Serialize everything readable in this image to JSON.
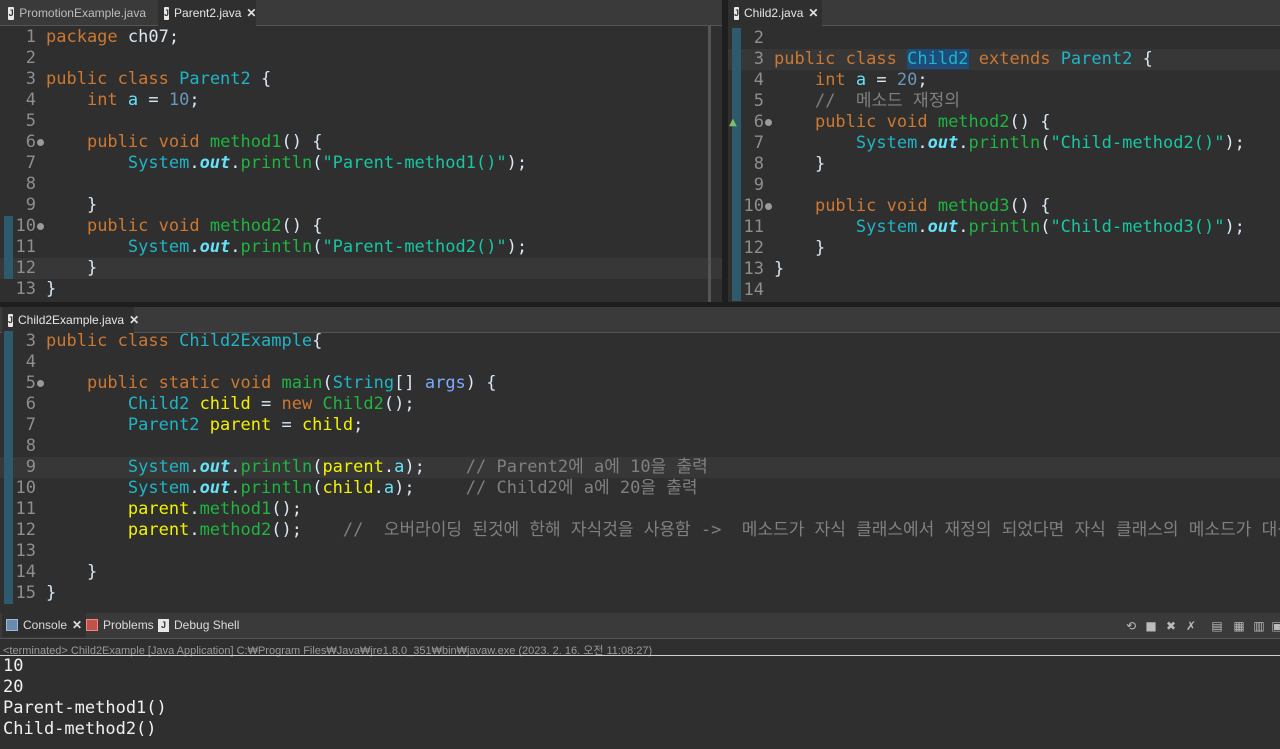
{
  "top_left": {
    "tabs": [
      {
        "label": "PromotionExample.java",
        "active": false,
        "closable": false
      },
      {
        "label": "Parent2.java",
        "active": true,
        "closable": true
      }
    ],
    "lines": [
      {
        "n": "1",
        "tokens": [
          [
            "kw",
            "package"
          ],
          [
            "plain",
            " ch07;"
          ]
        ]
      },
      {
        "n": "2",
        "tokens": []
      },
      {
        "n": "3",
        "tokens": [
          [
            "kw",
            "public"
          ],
          [
            "plain",
            " "
          ],
          [
            "kw",
            "class"
          ],
          [
            "plain",
            " "
          ],
          [
            "ty",
            "Parent2"
          ],
          [
            "plain",
            " {"
          ]
        ]
      },
      {
        "n": "4",
        "tokens": [
          [
            "plain",
            "    "
          ],
          [
            "kw",
            "int"
          ],
          [
            "plain",
            " "
          ],
          [
            "fld",
            "a"
          ],
          [
            "plain",
            " = "
          ],
          [
            "num",
            "10"
          ],
          [
            "plain",
            ";"
          ]
        ]
      },
      {
        "n": "5",
        "tokens": []
      },
      {
        "n": "6",
        "fold": true,
        "tokens": [
          [
            "plain",
            "    "
          ],
          [
            "kw",
            "public"
          ],
          [
            "plain",
            " "
          ],
          [
            "kw",
            "void"
          ],
          [
            "plain",
            " "
          ],
          [
            "fn",
            "method1"
          ],
          [
            "plain",
            "() {"
          ]
        ]
      },
      {
        "n": "7",
        "tokens": [
          [
            "plain",
            "        "
          ],
          [
            "ty",
            "System"
          ],
          [
            "plain",
            "."
          ],
          [
            "out",
            "out"
          ],
          [
            "plain",
            "."
          ],
          [
            "fn",
            "println"
          ],
          [
            "plain",
            "("
          ],
          [
            "st",
            "\"Parent-method1()\""
          ],
          [
            "plain",
            ");"
          ]
        ]
      },
      {
        "n": "8",
        "tokens": []
      },
      {
        "n": "9",
        "tokens": [
          [
            "plain",
            "    }"
          ]
        ]
      },
      {
        "n": "10",
        "fold": true,
        "mark": true,
        "tokens": [
          [
            "plain",
            "    "
          ],
          [
            "kw",
            "public"
          ],
          [
            "plain",
            " "
          ],
          [
            "kw",
            "void"
          ],
          [
            "plain",
            " "
          ],
          [
            "fn",
            "method2"
          ],
          [
            "plain",
            "() {"
          ]
        ]
      },
      {
        "n": "11",
        "mark": true,
        "tokens": [
          [
            "plain",
            "        "
          ],
          [
            "ty",
            "System"
          ],
          [
            "plain",
            "."
          ],
          [
            "out",
            "out"
          ],
          [
            "plain",
            "."
          ],
          [
            "fn",
            "println"
          ],
          [
            "plain",
            "("
          ],
          [
            "st",
            "\"Parent-method2()\""
          ],
          [
            "plain",
            ");"
          ]
        ]
      },
      {
        "n": "12",
        "mark": true,
        "highlight": true,
        "tokens": [
          [
            "plain",
            "    }"
          ]
        ]
      },
      {
        "n": "13",
        "tokens": [
          [
            "plain",
            "}"
          ]
        ]
      }
    ]
  },
  "top_right": {
    "tabs": [
      {
        "label": "Child2.java",
        "active": true,
        "closable": true
      }
    ],
    "lines": [
      {
        "n": "2",
        "tokens": []
      },
      {
        "n": "3",
        "highlight": true,
        "tokens": [
          [
            "kw",
            "public"
          ],
          [
            "plain",
            " "
          ],
          [
            "kw",
            "class"
          ],
          [
            "plain",
            " "
          ],
          [
            "tysel",
            "Child2"
          ],
          [
            "plain",
            " "
          ],
          [
            "kw",
            "extends"
          ],
          [
            "plain",
            " "
          ],
          [
            "ty",
            "Parent2"
          ],
          [
            "plain",
            " {"
          ]
        ]
      },
      {
        "n": "4",
        "tokens": [
          [
            "plain",
            "    "
          ],
          [
            "kw",
            "int"
          ],
          [
            "plain",
            " "
          ],
          [
            "fld",
            "a"
          ],
          [
            "plain",
            " = "
          ],
          [
            "num",
            "20"
          ],
          [
            "plain",
            ";"
          ]
        ]
      },
      {
        "n": "5",
        "tokens": [
          [
            "plain",
            "    "
          ],
          [
            "cm",
            "//  메소드 재정의"
          ]
        ]
      },
      {
        "n": "6",
        "fold": true,
        "override": true,
        "tokens": [
          [
            "plain",
            "    "
          ],
          [
            "kw",
            "public"
          ],
          [
            "plain",
            " "
          ],
          [
            "kw",
            "void"
          ],
          [
            "plain",
            " "
          ],
          [
            "fn",
            "method2"
          ],
          [
            "plain",
            "() {"
          ]
        ]
      },
      {
        "n": "7",
        "tokens": [
          [
            "plain",
            "        "
          ],
          [
            "ty",
            "System"
          ],
          [
            "plain",
            "."
          ],
          [
            "out",
            "out"
          ],
          [
            "plain",
            "."
          ],
          [
            "fn",
            "println"
          ],
          [
            "plain",
            "("
          ],
          [
            "st",
            "\"Child-method2()\""
          ],
          [
            "plain",
            ");"
          ]
        ]
      },
      {
        "n": "8",
        "tokens": [
          [
            "plain",
            "    }"
          ]
        ]
      },
      {
        "n": "9",
        "tokens": []
      },
      {
        "n": "10",
        "fold": true,
        "tokens": [
          [
            "plain",
            "    "
          ],
          [
            "kw",
            "public"
          ],
          [
            "plain",
            " "
          ],
          [
            "kw",
            "void"
          ],
          [
            "plain",
            " "
          ],
          [
            "fn",
            "method3"
          ],
          [
            "plain",
            "() {"
          ]
        ]
      },
      {
        "n": "11",
        "tokens": [
          [
            "plain",
            "        "
          ],
          [
            "ty",
            "System"
          ],
          [
            "plain",
            "."
          ],
          [
            "out",
            "out"
          ],
          [
            "plain",
            "."
          ],
          [
            "fn",
            "println"
          ],
          [
            "plain",
            "("
          ],
          [
            "st",
            "\"Child-method3()\""
          ],
          [
            "plain",
            ");"
          ]
        ]
      },
      {
        "n": "12",
        "tokens": [
          [
            "plain",
            "    }"
          ]
        ]
      },
      {
        "n": "13",
        "tokens": [
          [
            "plain",
            "}"
          ]
        ]
      },
      {
        "n": "14",
        "tokens": []
      }
    ]
  },
  "bottom": {
    "tabs": [
      {
        "label": "Child2Example.java",
        "active": true,
        "closable": true
      }
    ],
    "lines": [
      {
        "n": "3",
        "tokens": [
          [
            "kw",
            "public"
          ],
          [
            "plain",
            " "
          ],
          [
            "kw",
            "class"
          ],
          [
            "plain",
            " "
          ],
          [
            "ty",
            "Child2Example"
          ],
          [
            "plain",
            "{"
          ]
        ]
      },
      {
        "n": "4",
        "tokens": []
      },
      {
        "n": "5",
        "fold": true,
        "tokens": [
          [
            "plain",
            "    "
          ],
          [
            "kw",
            "public"
          ],
          [
            "plain",
            " "
          ],
          [
            "kw",
            "static"
          ],
          [
            "plain",
            " "
          ],
          [
            "kw",
            "void"
          ],
          [
            "plain",
            " "
          ],
          [
            "fn",
            "main"
          ],
          [
            "plain",
            "("
          ],
          [
            "ty",
            "String"
          ],
          [
            "plain",
            "[] "
          ],
          [
            "var",
            "args"
          ],
          [
            "plain",
            ") {"
          ]
        ]
      },
      {
        "n": "6",
        "tokens": [
          [
            "plain",
            "        "
          ],
          [
            "ty",
            "Child2"
          ],
          [
            "plain",
            " "
          ],
          [
            "loc",
            "child"
          ],
          [
            "plain",
            " = "
          ],
          [
            "kw",
            "new"
          ],
          [
            "plain",
            " "
          ],
          [
            "fn",
            "Child2"
          ],
          [
            "plain",
            "();"
          ]
        ]
      },
      {
        "n": "7",
        "tokens": [
          [
            "plain",
            "        "
          ],
          [
            "ty",
            "Parent2"
          ],
          [
            "plain",
            " "
          ],
          [
            "loc",
            "parent"
          ],
          [
            "plain",
            " = "
          ],
          [
            "loc",
            "child"
          ],
          [
            "plain",
            ";"
          ]
        ]
      },
      {
        "n": "8",
        "tokens": []
      },
      {
        "n": "9",
        "highlight": true,
        "tokens": [
          [
            "plain",
            "        "
          ],
          [
            "ty",
            "System"
          ],
          [
            "plain",
            "."
          ],
          [
            "out",
            "out"
          ],
          [
            "plain",
            "."
          ],
          [
            "fn",
            "println"
          ],
          [
            "plain",
            "("
          ],
          [
            "loc",
            "parent"
          ],
          [
            "plain",
            "."
          ],
          [
            "fld",
            "a"
          ],
          [
            "plain",
            ");    "
          ],
          [
            "cm",
            "// Parent2에 a에 10을 출력"
          ]
        ]
      },
      {
        "n": "10",
        "tokens": [
          [
            "plain",
            "        "
          ],
          [
            "ty",
            "System"
          ],
          [
            "plain",
            "."
          ],
          [
            "out",
            "out"
          ],
          [
            "plain",
            "."
          ],
          [
            "fn",
            "println"
          ],
          [
            "plain",
            "("
          ],
          [
            "loc",
            "child"
          ],
          [
            "plain",
            "."
          ],
          [
            "fld",
            "a"
          ],
          [
            "plain",
            ");     "
          ],
          [
            "cm",
            "// Child2에 a에 20을 출력"
          ]
        ]
      },
      {
        "n": "11",
        "tokens": [
          [
            "plain",
            "        "
          ],
          [
            "loc",
            "parent"
          ],
          [
            "plain",
            "."
          ],
          [
            "fn",
            "method1"
          ],
          [
            "plain",
            "();"
          ]
        ]
      },
      {
        "n": "12",
        "tokens": [
          [
            "plain",
            "        "
          ],
          [
            "loc",
            "parent"
          ],
          [
            "plain",
            "."
          ],
          [
            "fn",
            "method2"
          ],
          [
            "plain",
            "();    "
          ],
          [
            "cm",
            "//  오버라이딩 된것에 한해 자식것을 사용함 ->  메소드가 자식 클래스에서 재정의 되었다면 자식 클래스의 메소드가 대신 호출된다."
          ]
        ]
      },
      {
        "n": "13",
        "tokens": []
      },
      {
        "n": "14",
        "tokens": [
          [
            "plain",
            "    }"
          ]
        ]
      },
      {
        "n": "15",
        "tokens": [
          [
            "plain",
            "}"
          ]
        ]
      }
    ]
  },
  "console": {
    "tabs": [
      {
        "label": "Console",
        "active": true,
        "closable": true,
        "icon": "console-icon"
      },
      {
        "label": "Problems",
        "active": false,
        "closable": false,
        "icon": "problems-icon"
      },
      {
        "label": "Debug Shell",
        "active": false,
        "closable": false,
        "icon": "debug-shell-icon"
      }
    ],
    "toolbar": [
      "pin-icon",
      "stop-icon",
      "remove-launch-icon",
      "remove-all-icon",
      "copy-icon",
      "paste-icon",
      "scroll-lock-icon",
      "display-console-icon"
    ],
    "status": "<terminated> Child2Example [Java Application] C:₩Program Files₩Java₩jre1.8.0_351₩bin₩javaw.exe (2023. 2. 16. 오전 11:08:27)",
    "output": [
      "10",
      "20",
      "Parent-method1()",
      "Child-method2()"
    ]
  }
}
